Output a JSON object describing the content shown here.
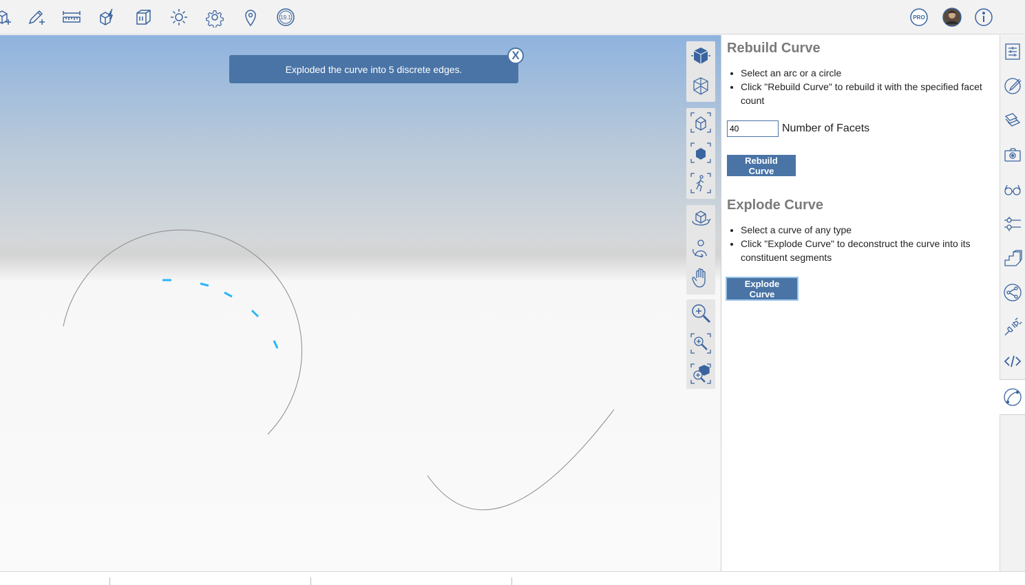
{
  "colors": {
    "accent": "#4a74a6",
    "icon": "#3a64a0",
    "highlight_segment": "#29b6f6",
    "curve": "#8a8a8a"
  },
  "toolbar": {
    "left_icons": [
      "box-plus-icon",
      "pencil-plus-icon",
      "ruler-icon",
      "box-lightning-icon",
      "box-frame-icon",
      "sun-icon",
      "gear-icon",
      "map-pin-icon",
      "version-badge-icon"
    ],
    "version_label": "19.1",
    "pro_label": "PRO",
    "right_icons": [
      "pro-badge-icon",
      "user-avatar",
      "info-icon"
    ]
  },
  "toast": {
    "message": "Exploded the curve into 5 discrete edges.",
    "close_label": "X"
  },
  "view_controls": [
    [
      "cube-solid-icon",
      "cube-wireframe-icon"
    ],
    [
      "zoom-extents-house-icon",
      "zoom-selection-icon",
      "walk-person-icon"
    ],
    [
      "orbit-icon",
      "look-around-icon",
      "pan-hand-icon"
    ],
    [
      "zoom-in-icon",
      "zoom-window-icon",
      "zoom-box-icon"
    ]
  ],
  "panel": {
    "rebuild": {
      "title": "Rebuild Curve",
      "steps": [
        "Select an arc or a circle",
        "Click \"Rebuild Curve\" to rebuild it with the specified facet count"
      ],
      "facets_value": "40",
      "facets_label": "Number of Facets",
      "button": "Rebuild Curve"
    },
    "explode": {
      "title": "Explode Curve",
      "steps": [
        "Select a curve of any type",
        "Click \"Explode Curve\" to deconstruct the curve into its constituent segments"
      ],
      "button": "Explode Curve"
    }
  },
  "side_tabs": [
    "properties-list-icon",
    "paint-brush-icon",
    "layers-icon",
    "camera-icon",
    "glasses-icon",
    "sliders-icon",
    "stairs-icon",
    "share-network-icon",
    "plugin-icon",
    "code-icon",
    "curve-tool-icon"
  ],
  "active_side_tab": "curve-tool-icon"
}
